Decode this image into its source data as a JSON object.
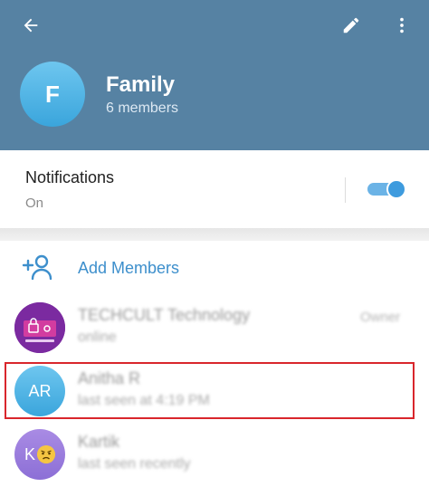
{
  "header": {
    "group_name": "Family",
    "members_count": "6 members",
    "avatar_letter": "F",
    "icons": {
      "back": "arrow-left-icon",
      "edit": "pencil-icon",
      "more": "more-vertical-icon"
    },
    "color": "#5682a3"
  },
  "notifications": {
    "title": "Notifications",
    "value": "On",
    "enabled": true
  },
  "add_members": {
    "label": "Add Members",
    "icon": "add-user-icon"
  },
  "members": [
    {
      "name": "TECHCULT Technology",
      "status": "online",
      "role": "Owner",
      "avatar_label": ""
    },
    {
      "name": "Anitha R",
      "status": "last seen at 4:19 PM",
      "role": "",
      "avatar_label": "AR"
    },
    {
      "name": "Kartik",
      "status": "last seen recently",
      "role": "",
      "avatar_label": "K"
    }
  ],
  "colors": {
    "accent": "#3d8fcc",
    "highlight": "#d9262c"
  }
}
